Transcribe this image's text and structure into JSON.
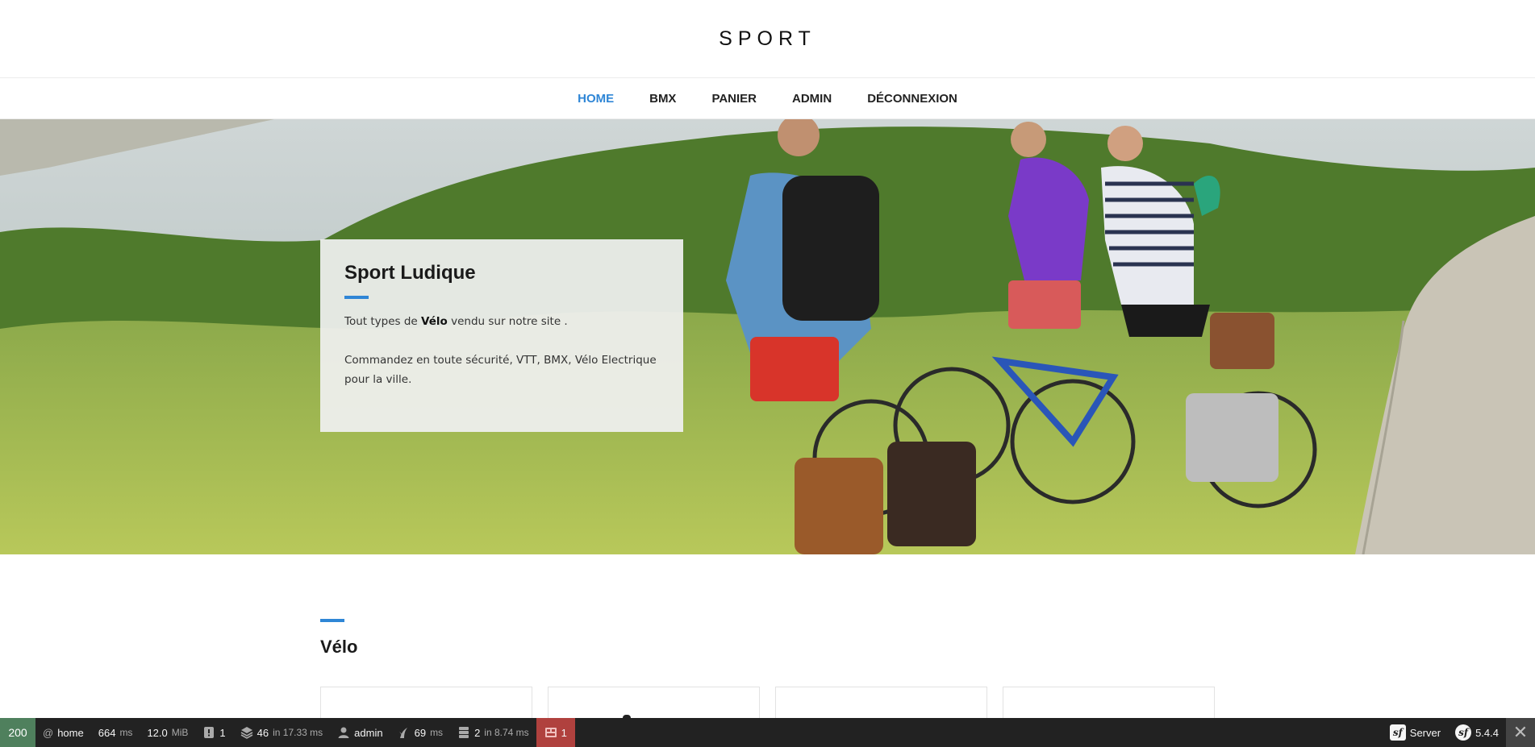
{
  "header": {
    "brand": "SPORT"
  },
  "nav": {
    "items": [
      {
        "label": "HOME",
        "active": true
      },
      {
        "label": "BMX",
        "active": false
      },
      {
        "label": "PANIER",
        "active": false
      },
      {
        "label": "ADMIN",
        "active": false
      },
      {
        "label": "DÉCONNEXION",
        "active": false
      }
    ]
  },
  "hero": {
    "title": "Sport Ludique",
    "line1_before": "Tout types de ",
    "line1_bold": "Vélo",
    "line1_after": " vendu sur notre site .",
    "line2": "Commandez en toute sécurité, VTT, BMX, Vélo Electrique pour la ville."
  },
  "section": {
    "title": "Vélo"
  },
  "colors": {
    "accent": "#2f86d6",
    "status_ok": "#4f805d",
    "error": "#b0413e"
  },
  "debug": {
    "status": "200",
    "route": "home",
    "time_value": "664",
    "time_unit": "ms",
    "memory_value": "12.0",
    "memory_unit": "MiB",
    "logs": "1",
    "twig_value": "46",
    "twig_unit": "in 17.33 ms",
    "user": "admin",
    "render_value": "69",
    "render_unit": "ms",
    "db_value": "2",
    "db_unit": "in 8.74 ms",
    "errors": "1",
    "server": "Server",
    "version": "5.4.4"
  }
}
